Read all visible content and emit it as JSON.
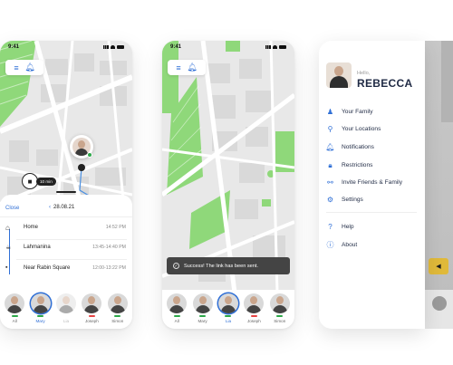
{
  "status_time": "9:41",
  "phone1": {
    "eta_label": "10 min",
    "close_label": "Close",
    "date": "28.08.21",
    "timeline": [
      {
        "place": "Home",
        "time": "14:52 PM"
      },
      {
        "place": "Lahmanina",
        "time": "13:45-14:40 PM"
      },
      {
        "place": "Near Rabin Square",
        "time": "12:00-13:22 PM"
      }
    ],
    "members": [
      {
        "name": "All",
        "status": "#2ea84a"
      },
      {
        "name": "Mary",
        "status": "#2ea84a"
      },
      {
        "name": "Lia",
        "status": "#ffffff"
      },
      {
        "name": "Joseph",
        "status": "#e64545"
      },
      {
        "name": "Simon",
        "status": "#2ea84a"
      }
    ]
  },
  "phone2": {
    "toast": "Success! The link has been sent.",
    "members": [
      {
        "name": "All",
        "status": "#2ea84a"
      },
      {
        "name": "Mary",
        "status": "#2ea84a"
      },
      {
        "name": "Lia",
        "status": "#2ea84a"
      },
      {
        "name": "Joseph",
        "status": "#e64545"
      },
      {
        "name": "Simon",
        "status": "#2ea84a"
      }
    ]
  },
  "drawer": {
    "greeting": "Hello,",
    "user_name": "REBECCA",
    "items": [
      {
        "label": "Your Family",
        "icon": "users-icon"
      },
      {
        "label": "Your Locations",
        "icon": "location-pin-icon"
      },
      {
        "label": "Notifications",
        "icon": "bell-icon"
      },
      {
        "label": "Restrictions",
        "icon": "lock-icon"
      },
      {
        "label": "Invite Friends & Family",
        "icon": "share-icon"
      },
      {
        "label": "Settings",
        "icon": "gear-icon"
      }
    ],
    "secondary": [
      {
        "label": "Help",
        "icon": "help-icon"
      },
      {
        "label": "About",
        "icon": "info-icon"
      }
    ]
  },
  "colors": {
    "accent": "#2f6fd6",
    "park": "#8fd87a",
    "road": "#ffffff",
    "map_bg": "#e8e8e8",
    "online": "#2ea84a",
    "offline": "#e64545"
  }
}
